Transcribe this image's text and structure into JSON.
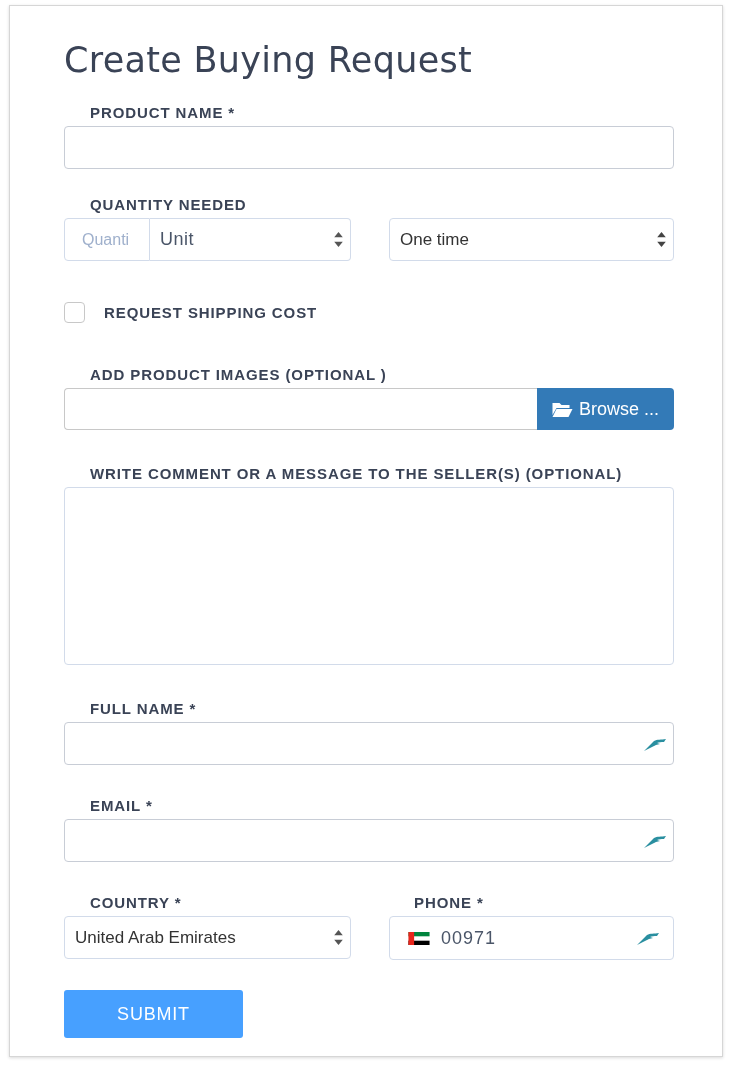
{
  "title": "Create Buying Request",
  "product_name": {
    "label": "PRODUCT NAME *"
  },
  "quantity": {
    "label": "QUANTITY NEEDED",
    "placeholder": "Quanti",
    "unit": "Unit",
    "frequency": "One time"
  },
  "shipping": {
    "label": "REQUEST SHIPPING COST",
    "checked": false
  },
  "images": {
    "label": "ADD PRODUCT IMAGES (OPTIONAL )",
    "button": "Browse ..."
  },
  "comment": {
    "label": "WRITE COMMENT OR A MESSAGE TO THE SELLER(S) (OPTIONAL)"
  },
  "full_name": {
    "label": "FULL NAME *"
  },
  "email": {
    "label": "EMAIL *"
  },
  "country": {
    "label": "COUNTRY *",
    "value": "United Arab Emirates"
  },
  "phone": {
    "label": "PHONE *",
    "value": "00971"
  },
  "submit": "SUBMIT"
}
